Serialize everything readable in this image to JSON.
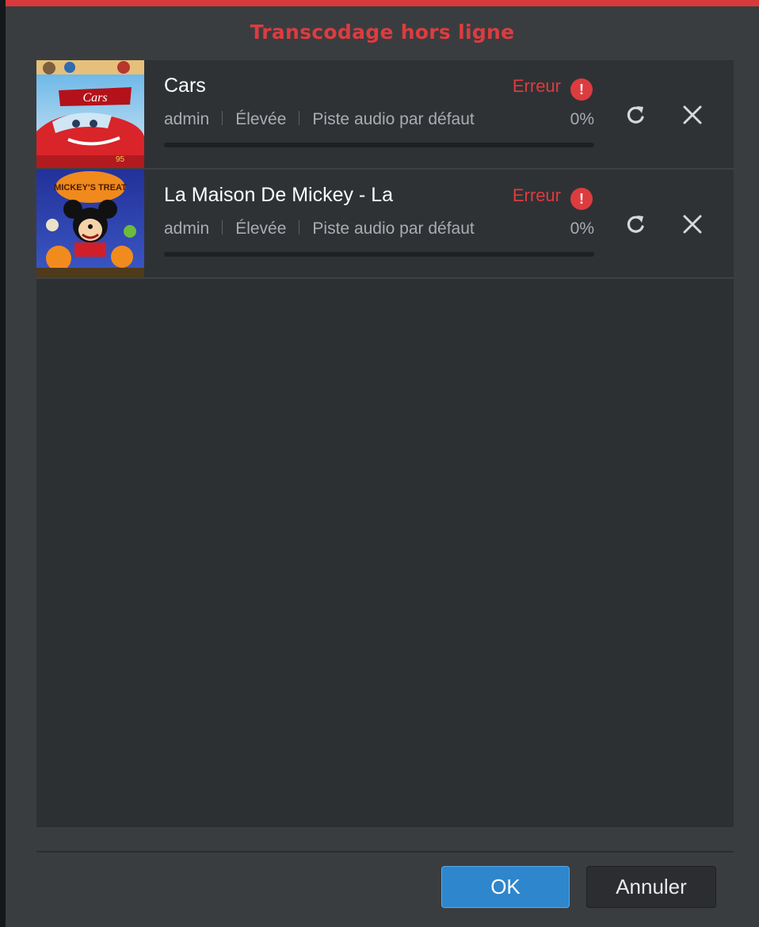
{
  "dialog": {
    "title": "Transcodage hors ligne",
    "ok_label": "OK",
    "cancel_label": "Annuler"
  },
  "items": [
    {
      "title": "Cars",
      "user": "admin",
      "priority": "Élevée",
      "audio": "Piste audio par défaut",
      "status": "Erreur",
      "percent": "0%",
      "progress": 0,
      "thumbnail": "cars-poster"
    },
    {
      "title": "La Maison De Mickey - La",
      "user": "admin",
      "priority": "Élevée",
      "audio": "Piste audio par défaut",
      "status": "Erreur",
      "percent": "0%",
      "progress": 0,
      "thumbnail": "mickeys-treat-poster"
    }
  ],
  "thumb_text": {
    "cars_logo": "Cars",
    "mickey_title": "MICKEY'S TREAT"
  },
  "colors": {
    "accent_red": "#dd3c3f",
    "primary_blue": "#2e86cc"
  }
}
